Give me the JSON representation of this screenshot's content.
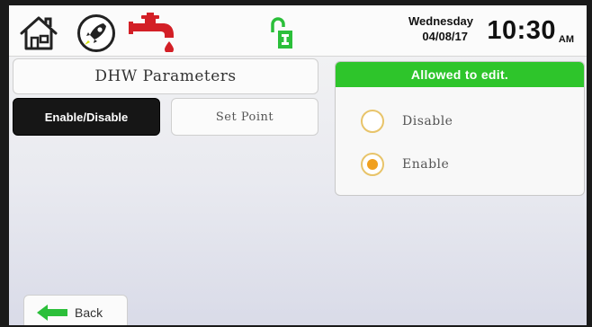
{
  "topbar": {
    "icons": [
      "home-icon",
      "rocket-icon",
      "water-tap-icon",
      "unlocked-icon"
    ],
    "datetime": {
      "day": "Wednesday",
      "date": "04/08/17",
      "time": "10:30",
      "ampm": "AM"
    }
  },
  "page": {
    "title": "DHW Parameters",
    "tabs": [
      {
        "label": "Enable/Disable",
        "active": true
      },
      {
        "label": "Set Point",
        "active": false
      }
    ]
  },
  "panel": {
    "header": "Allowed to edit.",
    "options": [
      {
        "label": "Disable",
        "selected": false
      },
      {
        "label": "Enable",
        "selected": true
      }
    ]
  },
  "footer": {
    "back_label": "Back"
  },
  "colors": {
    "header_green": "#2ec52b",
    "radio_selected": "#f0a020",
    "radio_ring": "#e8c46a",
    "tap_red": "#d31f26",
    "lock_green": "#2bbf3a",
    "active_tab": "#161616"
  }
}
